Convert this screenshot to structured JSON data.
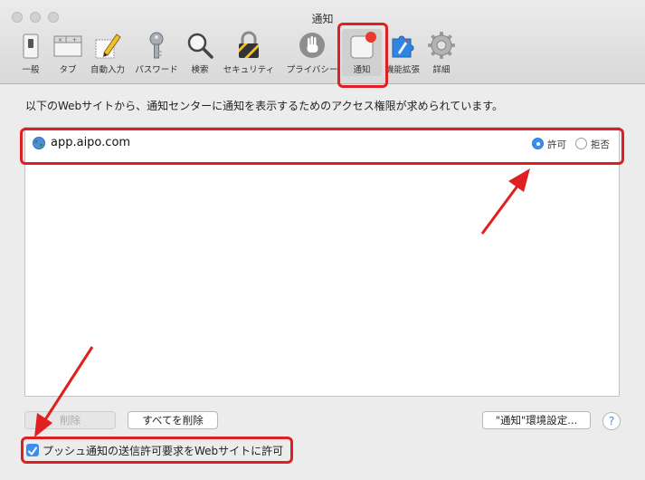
{
  "window": {
    "title": "通知"
  },
  "toolbar": {
    "items": [
      {
        "label": "一般",
        "icon": "switch-icon"
      },
      {
        "label": "タブ",
        "icon": "tabs-icon"
      },
      {
        "label": "自動入力",
        "icon": "pencil-icon"
      },
      {
        "label": "パスワード",
        "icon": "key-icon"
      },
      {
        "label": "検索",
        "icon": "search-icon"
      },
      {
        "label": "セキュリティ",
        "icon": "lock-icon"
      },
      {
        "label": "プライバシー",
        "icon": "hand-icon"
      },
      {
        "label": "通知",
        "icon": "notification-icon"
      },
      {
        "label": "機能拡張",
        "icon": "puzzle-icon"
      },
      {
        "label": "詳細",
        "icon": "gear-icon"
      }
    ],
    "selected": "通知"
  },
  "main": {
    "description": "以下のWebサイトから、通知センターに通知を表示するためのアクセス権限が求められています。",
    "sites": [
      {
        "name": "app.aipo.com",
        "allow_label": "許可",
        "deny_label": "拒否",
        "selected": "許可"
      }
    ]
  },
  "buttons": {
    "remove": "削除",
    "remove_all": "すべてを削除",
    "notification_prefs": "\"通知\"環境設定...",
    "help": "?"
  },
  "push_checkbox": {
    "label": "プッシュ通知の送信許可要求をWebサイトに許可",
    "checked": true
  },
  "colors": {
    "accent": "#3b8df0",
    "annotation": "#e02020"
  }
}
